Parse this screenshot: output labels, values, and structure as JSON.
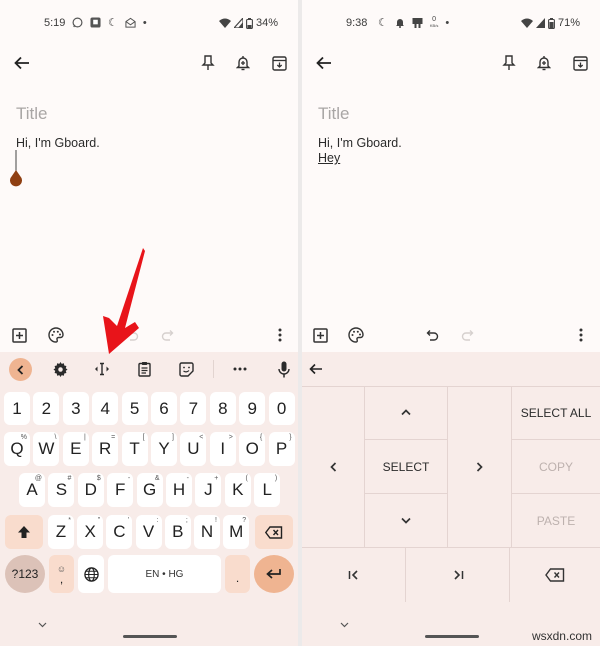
{
  "left": {
    "status": {
      "time": "5:19",
      "battery": "34%",
      "icons": [
        "whatsapp-icon",
        "app-notification-icon",
        "do-not-disturb-icon",
        "email-icon",
        "dot-icon"
      ]
    },
    "note": {
      "title_placeholder": "Title",
      "body_line1": "Hi, I'm Gboard."
    },
    "keyboard": {
      "row_numbers": [
        "1",
        "2",
        "3",
        "4",
        "5",
        "6",
        "7",
        "8",
        "9",
        "0"
      ],
      "row_q": [
        {
          "k": "Q",
          "h": "%"
        },
        {
          "k": "W",
          "h": "\\"
        },
        {
          "k": "E",
          "h": "|"
        },
        {
          "k": "R",
          "h": "="
        },
        {
          "k": "T",
          "h": "["
        },
        {
          "k": "Y",
          "h": "]"
        },
        {
          "k": "U",
          "h": "<"
        },
        {
          "k": "I",
          "h": ">"
        },
        {
          "k": "O",
          "h": "{"
        },
        {
          "k": "P",
          "h": "}"
        }
      ],
      "row_a": [
        {
          "k": "A",
          "h": "@"
        },
        {
          "k": "S",
          "h": "#"
        },
        {
          "k": "D",
          "h": "$"
        },
        {
          "k": "F",
          "h": "-"
        },
        {
          "k": "G",
          "h": "&"
        },
        {
          "k": "H",
          "h": "-"
        },
        {
          "k": "J",
          "h": "+"
        },
        {
          "k": "K",
          "h": "("
        },
        {
          "k": "L",
          "h": ")"
        }
      ],
      "row_z": [
        {
          "k": "Z",
          "h": "*"
        },
        {
          "k": "X",
          "h": "\""
        },
        {
          "k": "C",
          "h": "'"
        },
        {
          "k": "V",
          "h": ":"
        },
        {
          "k": "B",
          "h": ";"
        },
        {
          "k": "N",
          "h": "!"
        },
        {
          "k": "M",
          "h": "?"
        }
      ],
      "sym_label": "?123",
      "comma_label": ",",
      "space_label": "EN • HG",
      "period_label": "."
    }
  },
  "right": {
    "status": {
      "time": "9:38",
      "battery": "71%",
      "netspeed": "0",
      "netspeed_unit": "KB/s"
    },
    "note": {
      "title_placeholder": "Title",
      "body_line1": "Hi, I'm Gboard.",
      "body_line2": "Hey"
    },
    "edit_panel": {
      "select_all": "SELECT ALL",
      "select": "SELECT",
      "copy": "COPY",
      "paste": "PASTE"
    }
  },
  "watermark": "wsxdn.com",
  "colors": {
    "accent": "#efb491",
    "annotation_arrow": "#e8141a",
    "caret_handle": "#8f3f12"
  }
}
